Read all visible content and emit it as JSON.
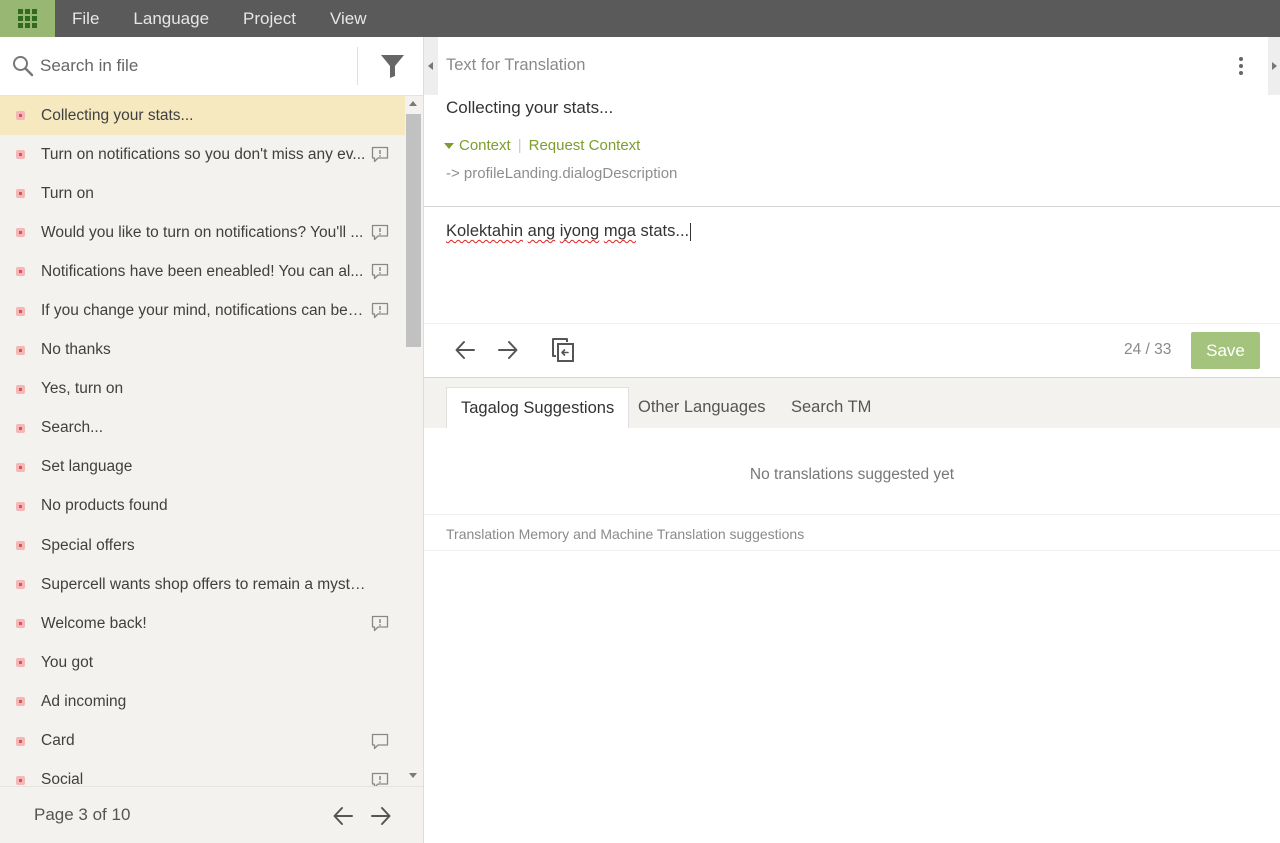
{
  "menu": [
    "File",
    "Language",
    "Project",
    "View"
  ],
  "search": {
    "placeholder": "Search in file"
  },
  "strings": [
    {
      "text": "Collecting your stats...",
      "active": true,
      "comment": "none"
    },
    {
      "text": "Turn on notifications so you don't miss any ev...",
      "comment": "issue"
    },
    {
      "text": "Turn on",
      "comment": "none"
    },
    {
      "text": "Would you like to turn on notifications? You'll ...",
      "comment": "issue"
    },
    {
      "text": "Notifications have been eneabled! You can al...",
      "comment": "issue"
    },
    {
      "text": "If you change your mind, notifications can be t...",
      "comment": "issue"
    },
    {
      "text": "No thanks",
      "comment": "none"
    },
    {
      "text": "Yes, turn on",
      "comment": "none"
    },
    {
      "text": "Search...",
      "comment": "none"
    },
    {
      "text": "Set language",
      "comment": "none"
    },
    {
      "text": "No products found",
      "comment": "none"
    },
    {
      "text": "Special offers",
      "comment": "none"
    },
    {
      "text": "Supercell wants shop offers to remain a mystery, ...",
      "comment": "none"
    },
    {
      "text": "Welcome back!",
      "comment": "issue"
    },
    {
      "text": "You got",
      "comment": "none"
    },
    {
      "text": "Ad incoming",
      "comment": "none"
    },
    {
      "text": "Card",
      "comment": "comment"
    },
    {
      "text": "Social",
      "comment": "issue"
    }
  ],
  "pager": {
    "label": "Page 3 of 10"
  },
  "editor": {
    "source_header": "Text for Translation",
    "source_text": "Collecting your stats...",
    "context_label": "Context",
    "request_context_label": "Request Context",
    "context_key": "-> profileLanding.dialogDescription",
    "translation_words": [
      {
        "w": "Kolektahin",
        "misspelled": true
      },
      {
        "w": " ",
        "misspelled": false
      },
      {
        "w": "ang",
        "misspelled": true
      },
      {
        "w": " ",
        "misspelled": false
      },
      {
        "w": "iyong",
        "misspelled": true
      },
      {
        "w": " ",
        "misspelled": false
      },
      {
        "w": "mga",
        "misspelled": true
      },
      {
        "w": " stats...",
        "misspelled": false
      }
    ],
    "counter": "24 / 33",
    "save_label": "Save"
  },
  "tabs": [
    "Tagalog Suggestions",
    "Other Languages",
    "Search TM"
  ],
  "suggestions": {
    "empty_text": "No translations suggested yet",
    "footer_label": "Translation Memory and Machine Translation suggestions"
  },
  "colors": {
    "accent": "#7e9c2f",
    "save": "#a4c47e",
    "apps": "#97b773",
    "topbar": "#5a5a5a",
    "active_row": "#f6e8bf"
  }
}
